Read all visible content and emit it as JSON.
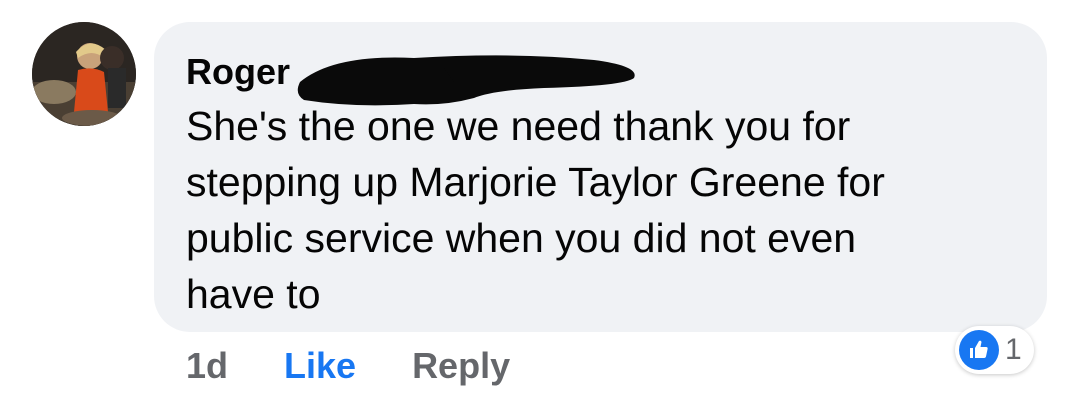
{
  "comment": {
    "author": "Roger",
    "text": "She's the one we need thank you for\nstepping up Marjorie Taylor Greene  for\npublic service when you did not even\nhave to",
    "timestamp": "1d",
    "like_label": "Like",
    "reply_label": "Reply",
    "reaction": {
      "icon": "thumbs-up-icon",
      "count": "1"
    }
  },
  "colors": {
    "bubble_bg": "#f0f2f5",
    "like_blue": "#1877f2",
    "secondary_text": "#65676b",
    "primary_text": "#050505"
  }
}
